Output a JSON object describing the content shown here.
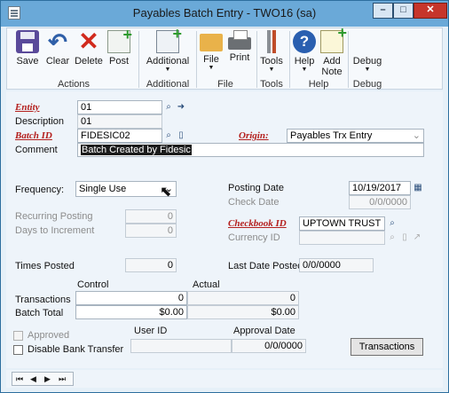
{
  "window": {
    "title": "Payables Batch Entry - TWO16 (sa)",
    "controls": {
      "minimize": "–",
      "maximize": "□",
      "close": "✕"
    }
  },
  "ribbon": {
    "buttons": {
      "save": {
        "label": "Save",
        "icon": "save-icon"
      },
      "clear": {
        "label": "Clear",
        "icon": "undo-icon"
      },
      "delete": {
        "label": "Delete",
        "icon": "delete-x-icon"
      },
      "post": {
        "label": "Post",
        "icon": "post-icon"
      },
      "additional": {
        "label": "Additional",
        "icon": "additional-icon"
      },
      "file": {
        "label": "File",
        "icon": "folder-icon"
      },
      "print": {
        "label": "Print",
        "icon": "printer-icon"
      },
      "tools": {
        "label": "Tools",
        "icon": "tools-icon"
      },
      "help": {
        "label": "Help",
        "icon": "help-icon"
      },
      "add_note": {
        "label_line1": "Add",
        "label_line2": "Note",
        "icon": "note-icon"
      },
      "debug": {
        "label": "Debug",
        "icon": "debug-icon"
      }
    },
    "groups": {
      "actions": "Actions",
      "additional": "Additional",
      "file": "File",
      "tools": "Tools",
      "help": "Help",
      "debug": "Debug"
    }
  },
  "form": {
    "entity": {
      "label": "Entity",
      "value": "01"
    },
    "description": {
      "label": "Description",
      "value": "01"
    },
    "batch_id": {
      "label": "Batch ID",
      "value": "FIDESIC02"
    },
    "origin": {
      "label": "Origin:",
      "value": "Payables Trx Entry"
    },
    "comment": {
      "label": "Comment",
      "value": "Batch Created by Fidesic"
    },
    "frequency": {
      "label": "Frequency:",
      "value": "Single Use"
    },
    "recurring_posting": {
      "label": "Recurring Posting",
      "value": "0"
    },
    "days_to_increment": {
      "label": "Days to Increment",
      "value": "0"
    },
    "times_posted": {
      "label": "Times Posted",
      "value": "0"
    },
    "posting_date": {
      "label": "Posting Date",
      "value": "10/19/2017"
    },
    "check_date": {
      "label": "Check Date",
      "value": "0/0/0000"
    },
    "checkbook_id": {
      "label": "Checkbook ID",
      "value": "UPTOWN TRUST"
    },
    "currency_id": {
      "label": "Currency ID",
      "value": ""
    },
    "last_date_posted": {
      "label": "Last Date Posted",
      "value": "0/0/0000"
    },
    "totals": {
      "control_header": "Control",
      "actual_header": "Actual",
      "transactions_label": "Transactions",
      "transactions_control": "0",
      "transactions_actual": "0",
      "batch_total_label": "Batch Total",
      "batch_total_control": "$0.00",
      "batch_total_actual": "$0.00"
    },
    "approved_label": "Approved",
    "disable_bank_transfer_label": "Disable Bank Transfer",
    "user_id": {
      "label": "User ID",
      "value": ""
    },
    "approval_date": {
      "label": "Approval Date",
      "value": "0/0/0000"
    },
    "transactions_button": "Transactions"
  },
  "navigation": {
    "first": "⏮",
    "prev": "◀",
    "next": "▶",
    "last": "⏭"
  },
  "colors": {
    "title_bar": "#6aa9d8",
    "required_label": "#b4201e",
    "form_background": "#eef4fa"
  }
}
